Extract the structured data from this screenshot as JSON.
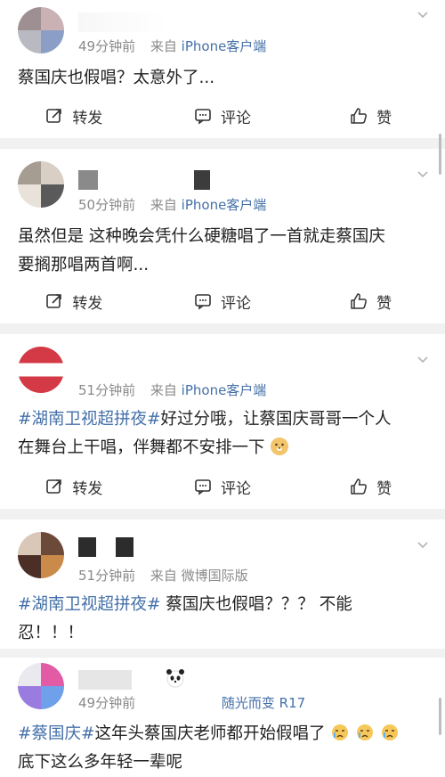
{
  "posts": [
    {
      "time": "49分钟前",
      "source_prefix": "来自",
      "source": "iPhone客户端",
      "content": "蔡国庆也假唱？太意外了...",
      "actions": {
        "repost": "转发",
        "comment": "评论",
        "like": "赞"
      }
    },
    {
      "time": "50分钟前",
      "source_prefix": "来自",
      "source": "iPhone客户端",
      "content_line1": "虽然但是 这种晚会凭什么硬糖唱了一首就走蔡国庆",
      "content_line2": "要搁那唱两首啊...",
      "actions": {
        "repost": "转发",
        "comment": "评论",
        "like": "赞"
      }
    },
    {
      "time": "51分钟前",
      "source_prefix": "来自",
      "source": "iPhone客户端",
      "hashtag": "#湖南卫视超拼夜#",
      "content_line1_rest": "好过分哦，让蔡国庆哥哥一个人",
      "content_line2": "在舞台上干唱，伴舞都不安排一下",
      "actions": {
        "repost": "转发",
        "comment": "评论",
        "like": "赞"
      }
    },
    {
      "time": "51分钟前",
      "source_prefix": "来自",
      "source": "微博国际版",
      "hashtag": "#湖南卫视超拼夜#",
      "content_line1_rest": " 蔡国庆也假唱？？？ 不能",
      "content_line2": "忍！！！"
    },
    {
      "time": "49分钟前",
      "source_prefix": "",
      "source": "随光而变 R17",
      "hashtag": "#蔡国庆#",
      "content_line1_rest": "这年头蔡国庆老师都开始假唱了",
      "content_line2": "底下这么多年轻一辈呢"
    }
  ],
  "colors": {
    "link": "#4470a8",
    "meta": "#8a8a8a",
    "separator": "#f1f1f1"
  },
  "icons": [
    "repost-icon",
    "comment-icon",
    "like-icon",
    "chevron-down-icon",
    "doge-emoji",
    "crying-emoji",
    "panda-emoji"
  ]
}
